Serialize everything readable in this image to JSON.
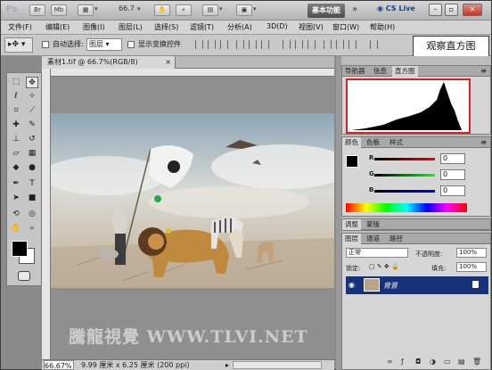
{
  "titlebar": {
    "app_icon": "Ps",
    "buttons": [
      "Br",
      "Mb"
    ],
    "zoom": "66.7",
    "workspace": "基本功能",
    "cs_live": "CS Live",
    "expand_glyph": "»"
  },
  "menus": [
    "文件(F)",
    "编辑(E)",
    "图像(I)",
    "图层(L)",
    "选择(S)",
    "滤镜(T)",
    "分析(A)",
    "3D(D)",
    "视图(V)",
    "窗口(W)",
    "帮助(H)"
  ],
  "options": {
    "auto_select_label": "自动选择:",
    "auto_select_value": "图层",
    "show_transform_label": "显示变换控件"
  },
  "callout": "观察直方图",
  "document": {
    "tab_label": "素材1.tif @ 66.7%(RGB/8)",
    "close_glyph": "×",
    "zoom_status": "66.67%",
    "doc_info": "9.99 厘米 x 6.25 厘米 (200 ppi)",
    "watermark": "騰龍視覺 WWW.TLVI.NET"
  },
  "panels": {
    "histogram_tabs": [
      "导航器",
      "信息",
      "直方图"
    ],
    "color_tabs": [
      "颜色",
      "色板",
      "样式"
    ],
    "channels": [
      {
        "label": "R",
        "value": "0",
        "color": "#d21010"
      },
      {
        "label": "G",
        "value": "0",
        "color": "#14a014"
      },
      {
        "label": "B",
        "value": "0",
        "color": "#1530d0"
      }
    ],
    "adjust_tabs": [
      "调整",
      "蒙版"
    ],
    "layer_tabs": [
      "图层",
      "通道",
      "路径"
    ],
    "blend_mode": "正常",
    "opacity_label": "不透明度:",
    "opacity_value": "100%",
    "lock_label": "锁定:",
    "fill_label": "填充:",
    "fill_value": "100%",
    "layer_name": "背景"
  },
  "colors": {
    "accent_red": "#e02020",
    "layer_selected": "#17317a",
    "workspace_button": "#5a5a5a"
  }
}
